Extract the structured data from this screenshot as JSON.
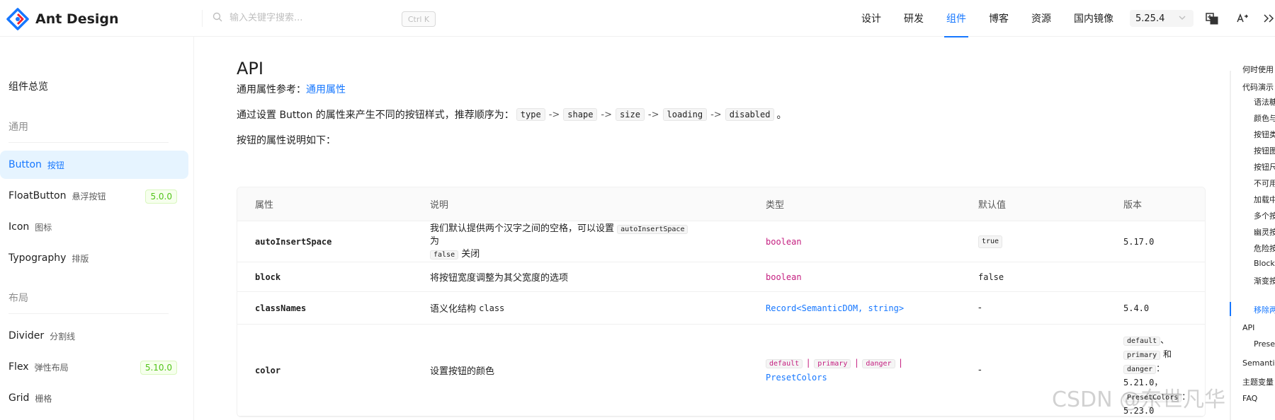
{
  "header": {
    "logo_text": "Ant Design",
    "search_placeholder": "输入关键字搜索...",
    "shortcut": "Ctrl K",
    "nav": [
      {
        "label": "设计"
      },
      {
        "label": "研发"
      },
      {
        "label": "组件",
        "active": true
      },
      {
        "label": "博客"
      },
      {
        "label": "资源"
      },
      {
        "label": "国内镜像"
      }
    ],
    "version": "5.25.4",
    "accent_color": "#1677ff"
  },
  "sidebar": {
    "overview": "组件总览",
    "groups": [
      {
        "label": "通用"
      },
      {
        "label": "布局"
      }
    ],
    "items": [
      {
        "en": "Button",
        "cn": "按钮",
        "selected": true
      },
      {
        "en": "FloatButton",
        "cn": "悬浮按钮",
        "badge": "5.0.0"
      },
      {
        "en": "Icon",
        "cn": "图标"
      },
      {
        "en": "Typography",
        "cn": "排版"
      },
      {
        "en": "Divider",
        "cn": "分割线"
      },
      {
        "en": "Flex",
        "cn": "弹性布局",
        "badge": "5.10.0"
      },
      {
        "en": "Grid",
        "cn": "栅格"
      }
    ]
  },
  "main": {
    "title": "API",
    "common_props_prefix": "通用属性参考：",
    "common_props_link": "通用属性",
    "order_prefix": "通过设置 Button 的属性来产生不同的按钮样式，推荐顺序为：",
    "order_props": [
      "type",
      "shape",
      "size",
      "loading",
      "disabled"
    ],
    "order_arrow": "->",
    "order_suffix": "。",
    "props_intro": "按钮的属性说明如下：",
    "table": {
      "headers": [
        "属性",
        "说明",
        "类型",
        "默认值",
        "版本"
      ],
      "rows": [
        {
          "prop": "autoInsertSpace",
          "desc_a": "我们默认提供两个汉字之间的空格，可以设置",
          "desc_code1": "autoInsertSpace",
          "desc_b": "为",
          "desc_code2": "false",
          "desc_c": "关闭",
          "type": "boolean",
          "default": "true",
          "version": "5.17.0"
        },
        {
          "prop": "block",
          "desc": "将按钮宽度调整为其父宽度的选项",
          "type": "boolean",
          "default": "false",
          "version": ""
        },
        {
          "prop": "classNames",
          "desc_a": "语义化结构",
          "desc_code": "class",
          "type": "Record<SemanticDOM, string>",
          "default": "-",
          "version": "5.4.0"
        },
        {
          "prop": "color",
          "desc": "设置按钮的颜色",
          "type_opts": [
            "default",
            "primary",
            "danger"
          ],
          "type_pipe": "|",
          "type_tail": "PresetColors",
          "default": "-",
          "version_code1": "default",
          "version_sep1": "、",
          "version_code2": "primary",
          "version_sep2": "和",
          "version_code3": "danger",
          "version_sep3": "：",
          "version_line1": "5.21.0，",
          "version_code4": "PresetColors",
          "version_sep4": "：",
          "version_line2": "5.23.0"
        }
      ]
    }
  },
  "anchor": {
    "items": [
      {
        "label": "何时使用",
        "level": 1
      },
      {
        "label": "代码演示",
        "level": 1
      },
      {
        "label": "语法糖",
        "level": 2
      },
      {
        "label": "颜色与",
        "level": 2
      },
      {
        "label": "按钮类型",
        "level": 2
      },
      {
        "label": "按钮图标",
        "level": 2
      },
      {
        "label": "按钮尺寸",
        "level": 2
      },
      {
        "label": "不可用",
        "level": 2
      },
      {
        "label": "加载中",
        "level": 2
      },
      {
        "label": "多个按钮",
        "level": 2
      },
      {
        "label": "幽灵按钮",
        "level": 2
      },
      {
        "label": "危险按钮",
        "level": 2
      },
      {
        "label": "Block",
        "level": 2
      },
      {
        "label": "渐变按钮",
        "level": 2
      },
      {
        "label": "移除两个",
        "level": 2,
        "active": true
      },
      {
        "label": "API",
        "level": 1
      },
      {
        "label": "PresetColors",
        "level": 2
      },
      {
        "label": "Semantic DOM",
        "level": 1
      },
      {
        "label": "主题变量",
        "level": 1
      },
      {
        "label": "FAQ",
        "level": 1
      }
    ]
  },
  "watermark": "CSDN @东世凡华"
}
